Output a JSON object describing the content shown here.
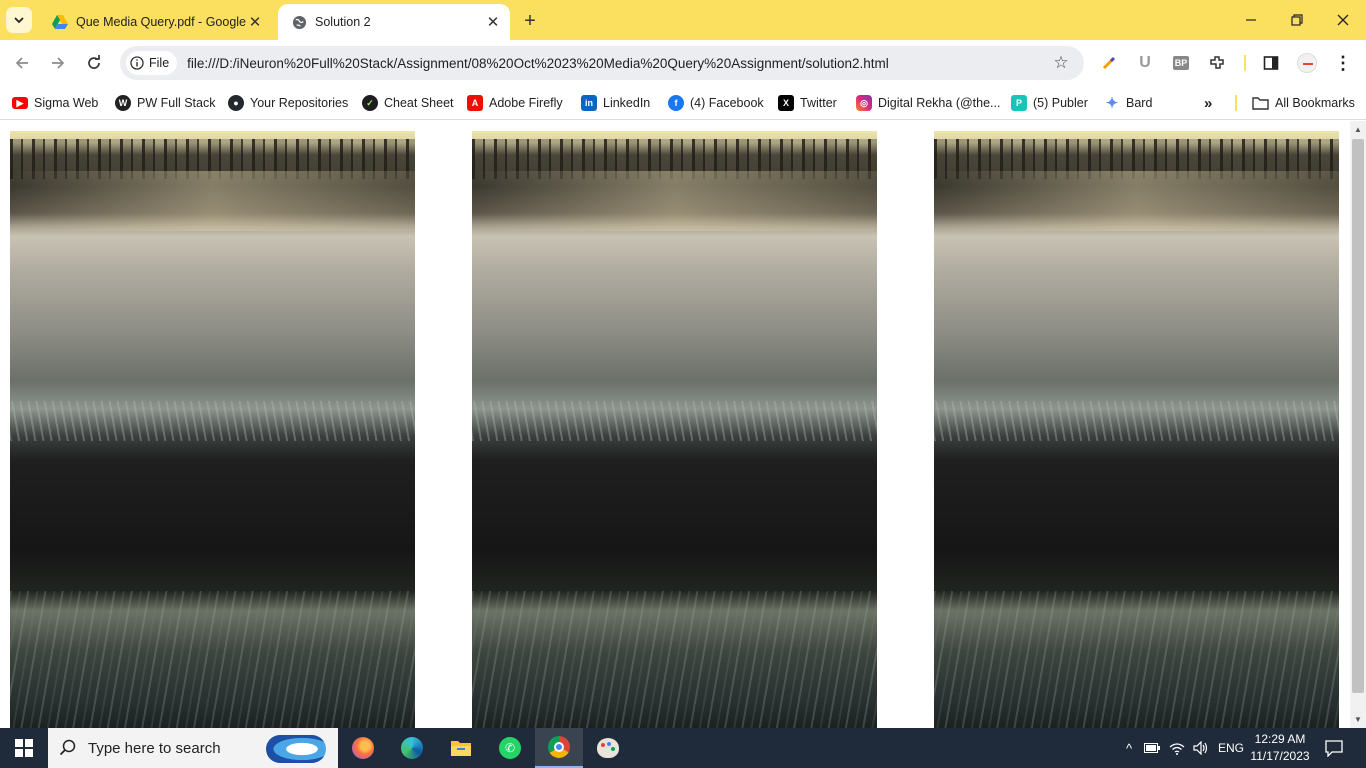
{
  "tabs": [
    {
      "title": "Que Media Query.pdf - Google",
      "favicon": "google-drive-icon",
      "active": false
    },
    {
      "title": "Solution 2",
      "favicon": "globe-icon",
      "active": true
    }
  ],
  "toolbar": {
    "site_chip_label": "File",
    "url": "file:///D:/iNeuron%20Full%20Stack/Assignment/08%20Oct%2023%20Media%20Query%20Assignment/solution2.html"
  },
  "bookmarks": [
    {
      "label": "Sigma Web",
      "icon": "youtube-icon",
      "color": "#ff0000"
    },
    {
      "label": "PW Full Stack",
      "icon": "pw-icon",
      "color": "#222222"
    },
    {
      "label": "Your Repositories",
      "icon": "github-icon",
      "color": "#24292f"
    },
    {
      "label": "Cheat Sheet",
      "icon": "cheat-sheet-icon",
      "color": "#1e1e1e"
    },
    {
      "label": "Adobe Firefly",
      "icon": "adobe-icon",
      "color": "#eb1000"
    },
    {
      "label": "LinkedIn",
      "icon": "linkedin-icon",
      "color": "#0a66c2"
    },
    {
      "label": "(4) Facebook",
      "icon": "facebook-icon",
      "color": "#1877f2"
    },
    {
      "label": "Twitter",
      "icon": "x-icon",
      "color": "#000000"
    },
    {
      "label": "Digital Rekha (@the...",
      "icon": "instagram-icon",
      "color": "#d6249f"
    },
    {
      "label": "(5) Publer",
      "icon": "publer-icon",
      "color": "#18c3b8"
    },
    {
      "label": "Bard",
      "icon": "bard-icon",
      "color": "#5b8def"
    }
  ],
  "all_bookmarks_label": "All Bookmarks",
  "content": {
    "images": [
      {
        "alt": "frosty-field-image-1"
      },
      {
        "alt": "frosty-field-image-2"
      },
      {
        "alt": "frosty-field-image-3"
      }
    ]
  },
  "taskbar": {
    "search_placeholder": "Type here to search",
    "language": "ENG",
    "time": "12:29 AM",
    "date": "11/17/2023"
  },
  "colors": {
    "tabstrip": "#fbe05f",
    "taskbar": "#1f2b3a"
  }
}
